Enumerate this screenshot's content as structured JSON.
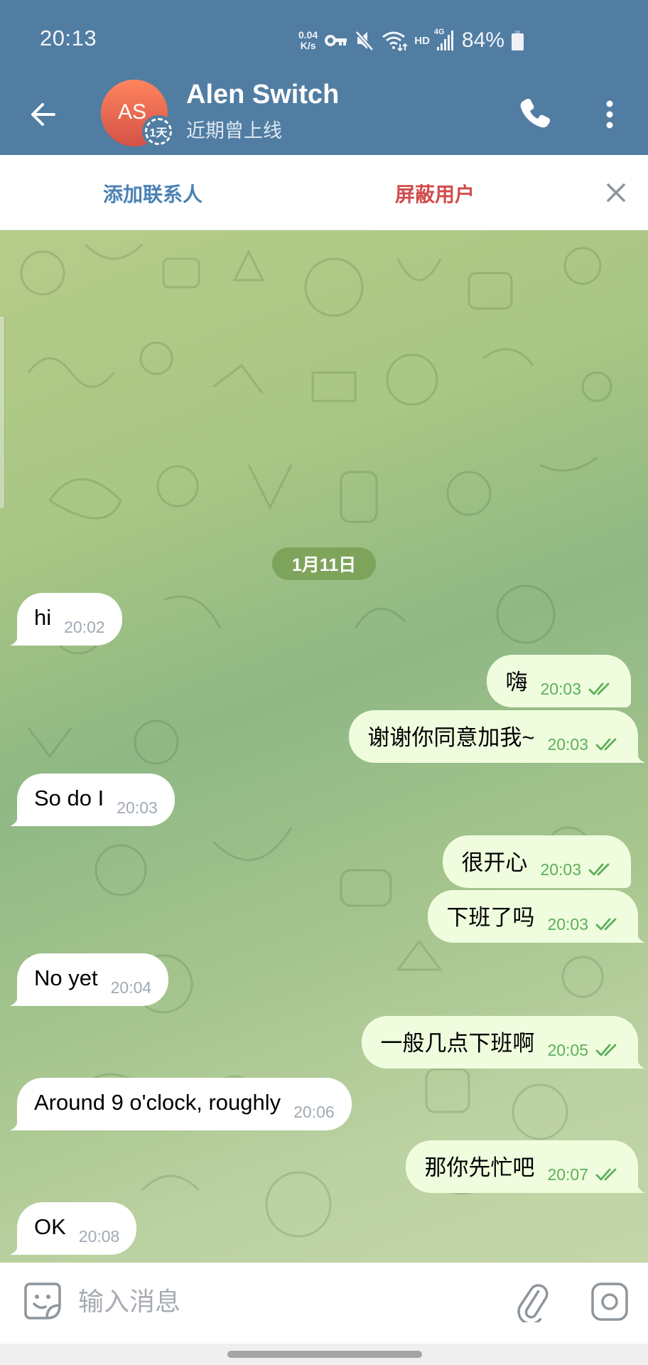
{
  "status_bar": {
    "time": "20:13",
    "net_speed_value": "0.04",
    "net_speed_unit": "K/s",
    "network_label": "HD",
    "signal_label": "4G",
    "battery_percent": "84%",
    "icons": [
      "vpn-key-icon",
      "mute-icon",
      "wifi-icon",
      "hd-icon",
      "signal-icon",
      "battery-icon"
    ]
  },
  "header": {
    "avatar_initials": "AS",
    "avatar_badge": "1天",
    "contact_name": "Alen Switch",
    "last_seen": "近期曾上线",
    "icons": [
      "back-arrow-icon",
      "phone-icon",
      "more-vertical-icon"
    ]
  },
  "action_bar": {
    "add_contact": "添加联系人",
    "block_user": "屏蔽用户",
    "close_icon": "close-icon"
  },
  "chat": {
    "date_separator": "1月11日",
    "messages": [
      {
        "direction": "in",
        "text": "hi",
        "time": "20:02"
      },
      {
        "direction": "out",
        "text": "嗨",
        "time": "20:03",
        "read": true
      },
      {
        "direction": "out",
        "text": "谢谢你同意加我~",
        "time": "20:03",
        "read": true
      },
      {
        "direction": "in",
        "text": "So do I",
        "time": "20:03"
      },
      {
        "direction": "out",
        "text": "很开心",
        "time": "20:03",
        "read": true
      },
      {
        "direction": "out",
        "text": "下班了吗",
        "time": "20:03",
        "read": true
      },
      {
        "direction": "in",
        "text": "No yet",
        "time": "20:04"
      },
      {
        "direction": "out",
        "text": "一般几点下班啊",
        "time": "20:05",
        "read": true
      },
      {
        "direction": "in",
        "text": "Around 9 o'clock, roughly",
        "time": "20:06"
      },
      {
        "direction": "out",
        "text": "那你先忙吧",
        "time": "20:07",
        "read": true
      },
      {
        "direction": "in",
        "text": "OK",
        "time": "20:08"
      }
    ]
  },
  "composer": {
    "placeholder": "输入消息",
    "value": "",
    "icons": [
      "sticker-icon",
      "attach-icon",
      "camera-icon"
    ]
  },
  "colors": {
    "header_bg": "#517da2",
    "add_contact": "#4a82b4",
    "block_user": "#d14c4c",
    "incoming_bubble": "#ffffff",
    "outgoing_bubble": "#effdde",
    "outgoing_meta": "#5dae5a",
    "incoming_meta": "#a1aab3",
    "date_pill": "#7ea45b",
    "avatar_top": "#ff845e",
    "avatar_bottom": "#d45246"
  }
}
